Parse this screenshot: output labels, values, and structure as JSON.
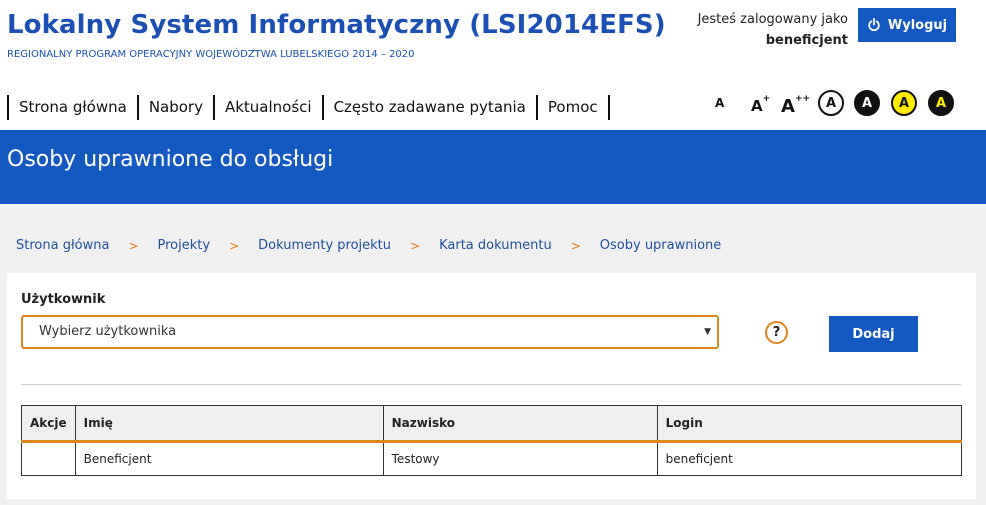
{
  "app": {
    "title": "Lokalny System Informatyczny (LSI2014EFS)",
    "subtitle": "REGIONALNY PROGRAM OPERACYJNY WOJEWÓDZTWA LUBELSKIEGO 2014 – 2020"
  },
  "session": {
    "logged_in_label": "Jesteś zalogowany jako",
    "username": "beneficjent",
    "logout_label": "Wyloguj",
    "logout_icon": "power-icon"
  },
  "nav": {
    "items": [
      {
        "label": "Strona główna"
      },
      {
        "label": "Nabory"
      },
      {
        "label": "Aktualności"
      },
      {
        "label": "Często zadawane pytania"
      },
      {
        "label": "Pomoc"
      }
    ]
  },
  "accessibility": {
    "font_small": "A",
    "font_medium": "A",
    "font_medium_sup": "+",
    "font_large": "A",
    "font_large_sup": "++",
    "contrast_default": "A",
    "contrast_black_white": "A",
    "contrast_yellow_black": "A",
    "contrast_black_yellow": "A"
  },
  "page": {
    "title": "Osoby uprawnione do obsługi"
  },
  "breadcrumb": {
    "items": [
      {
        "label": "Strona główna"
      },
      {
        "label": "Projekty"
      },
      {
        "label": "Dokumenty projektu"
      },
      {
        "label": "Karta dokumentu"
      },
      {
        "label": "Osoby uprawnione"
      }
    ],
    "separator": ">"
  },
  "form": {
    "user_label": "Użytkownik",
    "user_select_value": "Wybierz użytkownika",
    "help_label": "?",
    "add_label": "Dodaj"
  },
  "table": {
    "headers": [
      "Akcje",
      "Imię",
      "Nazwisko",
      "Login"
    ],
    "rows": [
      {
        "akcje": "",
        "imie": "Beneficjent",
        "nazwisko": "Testowy",
        "login": "beneficjent"
      }
    ]
  },
  "colors": {
    "brand_blue": "#1458c1",
    "accent_orange": "#e0861f",
    "title_blue": "#1a4fb3"
  }
}
